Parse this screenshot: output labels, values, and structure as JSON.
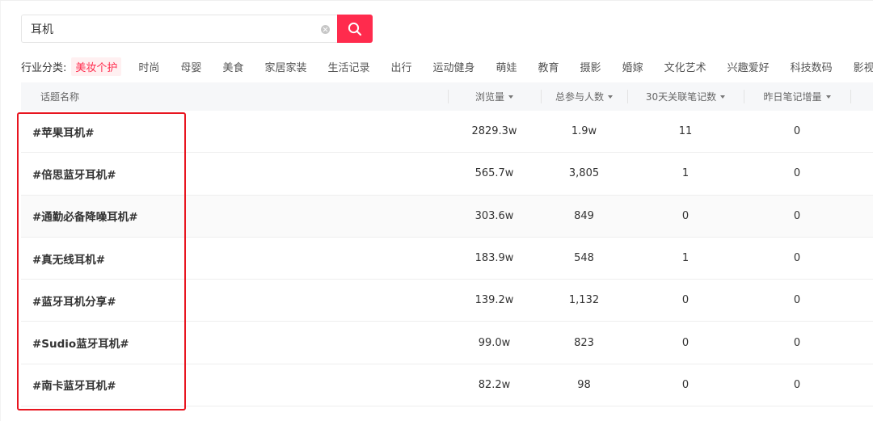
{
  "search": {
    "value": "耳机"
  },
  "categories": {
    "label": "行业分类:",
    "items": [
      {
        "label": "美妆个护",
        "active": true
      },
      {
        "label": "时尚"
      },
      {
        "label": "母婴"
      },
      {
        "label": "美食"
      },
      {
        "label": "家居家装"
      },
      {
        "label": "生活记录"
      },
      {
        "label": "出行"
      },
      {
        "label": "运动健身"
      },
      {
        "label": "萌娃"
      },
      {
        "label": "教育"
      },
      {
        "label": "摄影"
      },
      {
        "label": "婚嫁"
      },
      {
        "label": "文化艺术"
      },
      {
        "label": "兴趣爱好"
      },
      {
        "label": "科技数码"
      },
      {
        "label": "影视综"
      }
    ]
  },
  "table": {
    "headers": {
      "name": "话题名称",
      "views": "浏览量",
      "participants": "总参与人数",
      "notes30": "30天关联笔记数",
      "yesterday": "昨日笔记增量"
    },
    "rows": [
      {
        "name": "#苹果耳机#",
        "views": "2829.3w",
        "participants": "1.9w",
        "notes30": "11",
        "yesterday": "0"
      },
      {
        "name": "#倍思蓝牙耳机#",
        "views": "565.7w",
        "participants": "3,805",
        "notes30": "1",
        "yesterday": "0"
      },
      {
        "name": "#通勤必备降噪耳机#",
        "views": "303.6w",
        "participants": "849",
        "notes30": "0",
        "yesterday": "0"
      },
      {
        "name": "#真无线耳机#",
        "views": "183.9w",
        "participants": "548",
        "notes30": "1",
        "yesterday": "0"
      },
      {
        "name": "#蓝牙耳机分享#",
        "views": "139.2w",
        "participants": "1,132",
        "notes30": "0",
        "yesterday": "0"
      },
      {
        "name": "#Sudio蓝牙耳机#",
        "views": "99.0w",
        "participants": "823",
        "notes30": "0",
        "yesterday": "0"
      },
      {
        "name": "#南卡蓝牙耳机#",
        "views": "82.2w",
        "participants": "98",
        "notes30": "0",
        "yesterday": "0"
      }
    ]
  },
  "colors": {
    "accent": "#ff2b4d",
    "highlight": "#e8151f"
  }
}
